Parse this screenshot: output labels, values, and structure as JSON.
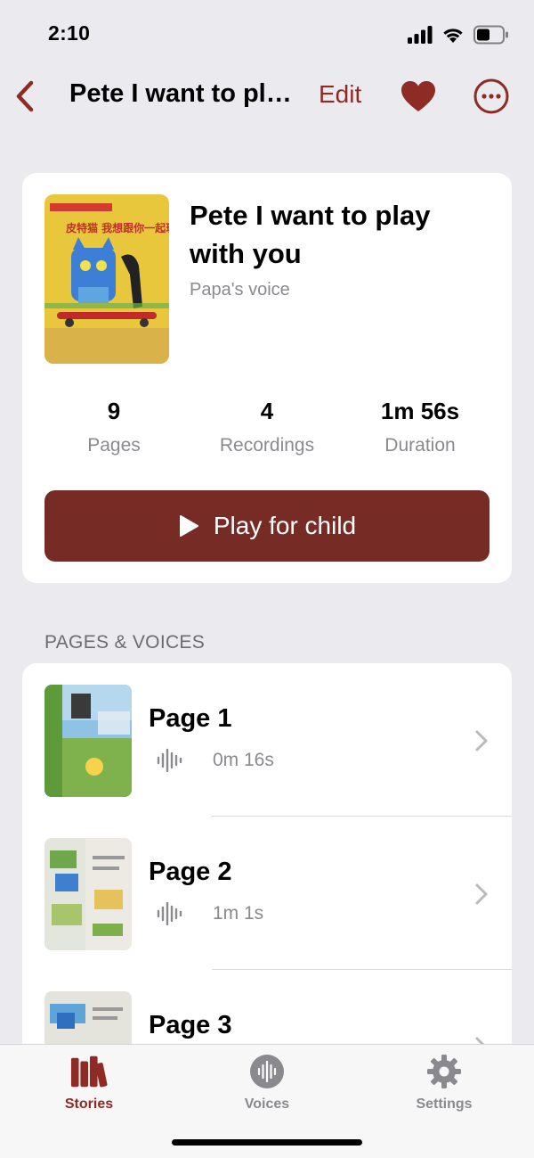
{
  "status_bar": {
    "time": "2:10",
    "icons": [
      "signal-icon",
      "wifi-icon",
      "battery-icon"
    ]
  },
  "nav": {
    "back_icon": "chevron-left-icon",
    "title": "Pete I want to play with you",
    "edit_label": "Edit",
    "favorite_icon": "heart-icon",
    "more_icon": "ellipsis-circle-icon"
  },
  "story": {
    "title": "Pete I want to play with you",
    "subtitle": "Papa's voice",
    "cover_text": "皮特猫 我想跟你一起玩!",
    "stats": [
      {
        "value": "9",
        "label": "Pages"
      },
      {
        "value": "4",
        "label": "Recordings"
      },
      {
        "value": "1m 56s",
        "label": "Duration"
      }
    ],
    "play_label": "Play for child",
    "play_icon": "play-icon"
  },
  "section_header": "PAGES & VOICES",
  "pages": [
    {
      "title": "Page 1",
      "duration": "0m 16s"
    },
    {
      "title": "Page 2",
      "duration": "1m 1s"
    },
    {
      "title": "Page 3",
      "duration": ""
    }
  ],
  "tabs": [
    {
      "label": "Stories",
      "icon": "books-icon",
      "active": true
    },
    {
      "label": "Voices",
      "icon": "waveform-circle-icon",
      "active": false
    },
    {
      "label": "Settings",
      "icon": "gear-icon",
      "active": false
    }
  ],
  "colors": {
    "accent": "#8e2b25",
    "button": "#772b25",
    "background": "#ebebef",
    "secondary_text": "#8a8a8e"
  }
}
